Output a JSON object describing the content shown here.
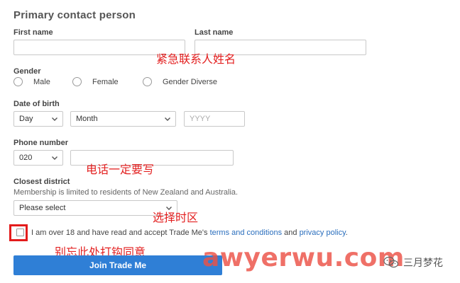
{
  "section_title": "Primary contact person",
  "first_name": {
    "label": "First name",
    "value": "",
    "placeholder": ""
  },
  "last_name": {
    "label": "Last name",
    "value": "",
    "placeholder": ""
  },
  "gender": {
    "label": "Gender",
    "options": [
      "Male",
      "Female",
      "Gender Diverse"
    ]
  },
  "dob": {
    "label": "Date of birth",
    "day": "Day",
    "month": "Month",
    "year_placeholder": "YYYY"
  },
  "phone": {
    "label": "Phone number",
    "prefix": "020",
    "value": "",
    "placeholder": ""
  },
  "district": {
    "label": "Closest district",
    "help": "Membership is limited to residents of New Zealand and Australia.",
    "selected": "Please select"
  },
  "terms": {
    "prefix": "I am over 18 and have read and accept Trade Me's ",
    "link1": "terms and conditions",
    "middle": " and ",
    "link2": "privacy policy",
    "suffix": "."
  },
  "join_button": "Join Trade Me",
  "annotations": {
    "name": "紧急联系人姓名",
    "phone": "电话一定要写",
    "district": "选择时区",
    "checkbox": "别忘此处打钩同意"
  },
  "watermark": "awyerwu.com",
  "wechat_account": "三月梦花",
  "colors": {
    "accent_blue": "#2f7fd6",
    "link_blue": "#2a6ebd",
    "annotation_red": "#e32020",
    "watermark_red": "#eb5046"
  },
  "icons": [
    "chevron-down-icon",
    "wechat-icon"
  ]
}
